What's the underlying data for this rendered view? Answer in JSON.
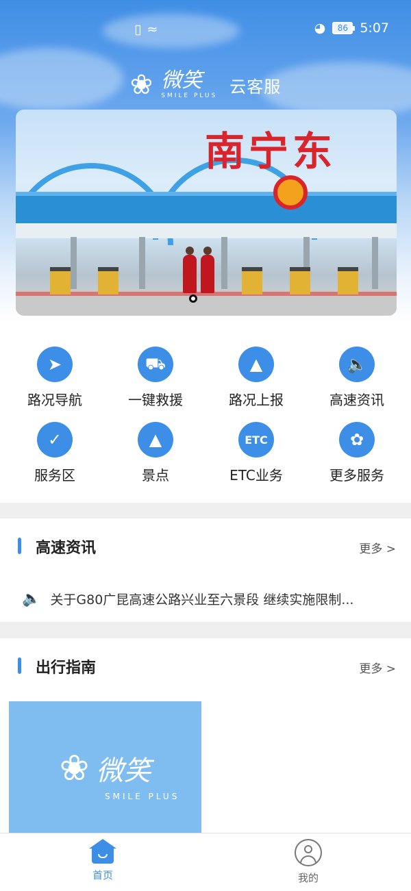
{
  "status_bar": {
    "time": "5:07",
    "battery": "86"
  },
  "header": {
    "logo_text": "微笑",
    "logo_sub": "SMILE PLUS",
    "service_title": "云客服"
  },
  "banner": {
    "station_name": "南宁东"
  },
  "services": [
    {
      "label": "路况导航",
      "icon": "navigation-arrow-icon"
    },
    {
      "label": "一键救援",
      "icon": "tow-truck-icon"
    },
    {
      "label": "路况上报",
      "icon": "alarm-light-icon"
    },
    {
      "label": "高速资讯",
      "icon": "speaker-icon"
    },
    {
      "label": "服务区",
      "icon": "map-pin-route-icon"
    },
    {
      "label": "景点",
      "icon": "mountain-pin-icon"
    },
    {
      "label": "ETC业务",
      "icon": "etc-icon"
    },
    {
      "label": "更多服务",
      "icon": "four-petal-grid-icon"
    }
  ],
  "news": {
    "title": "高速资讯",
    "more": "更多 >",
    "item": "关于G80广昆高速公路兴业至六景段 继续实施限制..."
  },
  "guide": {
    "title": "出行指南",
    "more": "更多 >",
    "image_text": "微笑",
    "image_sub": "SMILE PLUS"
  },
  "tabbar": {
    "home": "首页",
    "mine": "我的",
    "active_color": "#3d8ee6",
    "inactive_color": "#666666"
  },
  "colors": {
    "accent": "#3d8ee6",
    "highlight": "#e9a810"
  }
}
